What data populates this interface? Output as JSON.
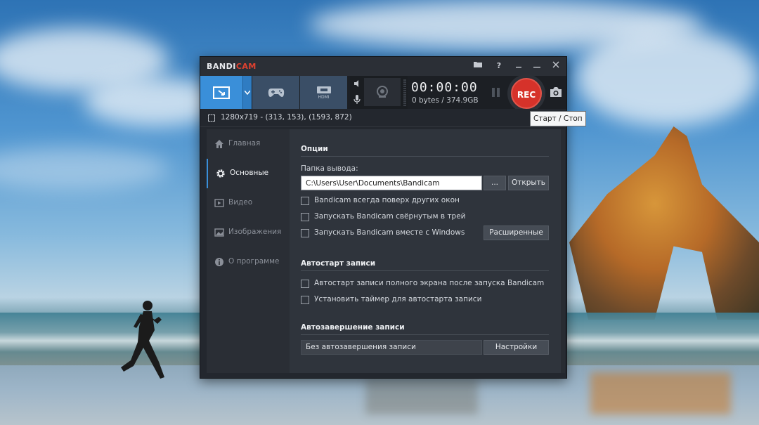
{
  "window": {
    "logo_part1": "BANDI",
    "logo_part2": "CAM",
    "tooltip": "Старт / Стоп"
  },
  "toolbar": {
    "modes": [
      {
        "id": "screen",
        "icon": "screen-area-icon",
        "active": true
      },
      {
        "id": "game",
        "icon": "gamepad-icon",
        "active": false
      },
      {
        "id": "device",
        "icon": "hdmi-device-icon",
        "active": false
      }
    ],
    "hdmi_label": "HDMI",
    "timer": "00:00:00",
    "size": "0 bytes / 374.9GB",
    "rec_label": "REC"
  },
  "infobar": {
    "region": "1280x719 - (313, 153), (1593, 872)"
  },
  "sidebar": {
    "items": [
      {
        "label": "Главная",
        "icon": "home-icon",
        "active": false
      },
      {
        "label": "Основные",
        "icon": "gear-icon",
        "active": true
      },
      {
        "label": "Видео",
        "icon": "video-icon",
        "active": false
      },
      {
        "label": "Изображения",
        "icon": "image-icon",
        "active": false
      },
      {
        "label": "О программе",
        "icon": "info-icon",
        "active": false
      }
    ]
  },
  "options": {
    "section_title": "Опции",
    "output_label": "Папка вывода:",
    "output_path": "C:\\Users\\User\\Documents\\Bandicam",
    "browse_label": "...",
    "open_label": "Открыть",
    "checkboxes": [
      {
        "label": "Bandicam всегда поверх других окон",
        "checked": false
      },
      {
        "label": "Запускать Bandicam свёрнутым в трей",
        "checked": false
      },
      {
        "label": "Запускать Bandicam вместе с Windows",
        "checked": false
      }
    ],
    "advanced_label": "Расширенные"
  },
  "autostart": {
    "section_title": "Автостарт записи",
    "checkboxes": [
      {
        "label": "Автостарт записи полного экрана после запуска Bandicam",
        "checked": false
      },
      {
        "label": "Установить таймер для автостарта записи",
        "checked": false
      }
    ]
  },
  "autocomplete": {
    "section_title": "Автозавершение записи",
    "value": "Без автозавершения записи",
    "settings_label": "Настройки"
  }
}
